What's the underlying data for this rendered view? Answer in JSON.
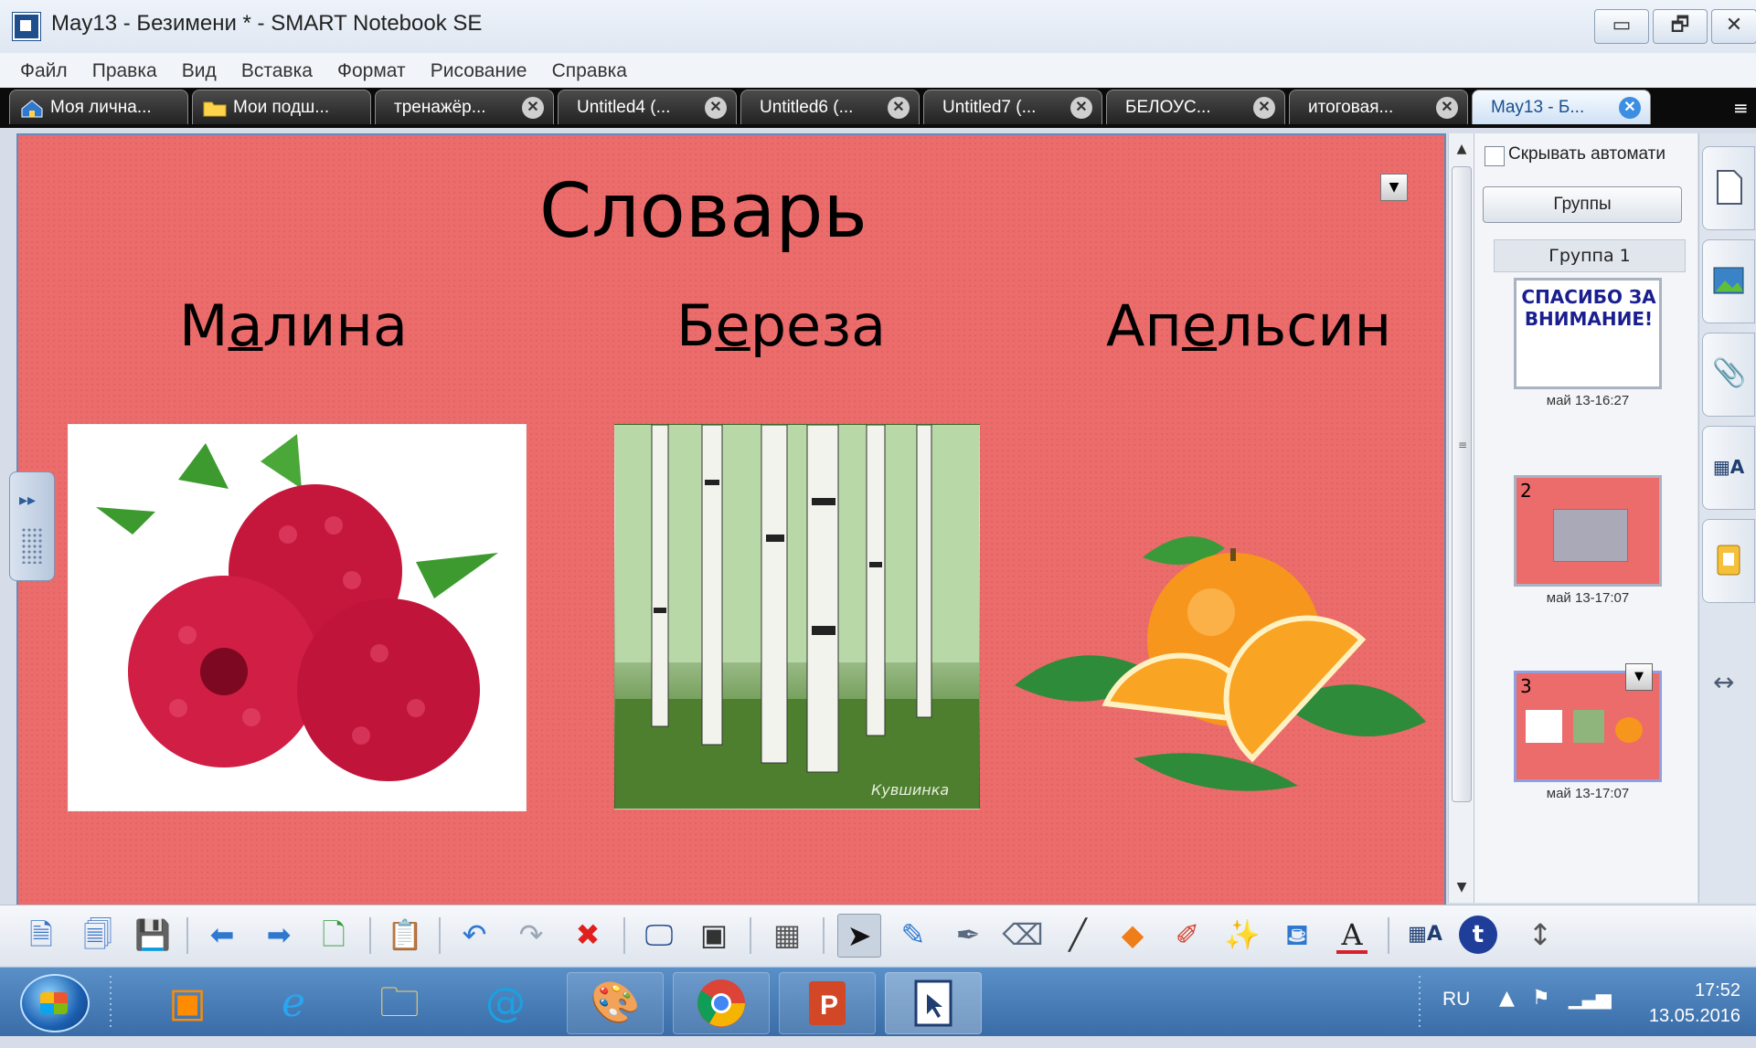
{
  "window": {
    "title": "May13 - Безимени * - SMART Notebook SE",
    "buttons": [
      "▭",
      "🗗",
      "✕"
    ]
  },
  "menu": [
    "Файл",
    "Правка",
    "Вид",
    "Вставка",
    "Формат",
    "Рисование",
    "Справка"
  ],
  "tabs": [
    {
      "label": "Моя лична...",
      "icon": "home-icon",
      "closable": false
    },
    {
      "label": "Мои подш...",
      "icon": "folder-icon",
      "closable": false
    },
    {
      "label": "тренажёр...",
      "closable": true
    },
    {
      "label": "Untitled4 (...",
      "closable": true
    },
    {
      "label": "Untitled6 (...",
      "closable": true
    },
    {
      "label": "Untitled7 (...",
      "closable": true
    },
    {
      "label": "БЕЛОУС...",
      "closable": true
    },
    {
      "label": "итоговая...",
      "closable": true
    },
    {
      "label": "May13 - Б...",
      "closable": true,
      "active": true
    }
  ],
  "slide": {
    "title": "Словарь",
    "words": [
      {
        "before": "М",
        "underlined": "а",
        "after": "лина"
      },
      {
        "before": "Б",
        "underlined": "е",
        "after": "реза"
      },
      {
        "before": "Ап",
        "underlined": "е",
        "after": "льсин"
      }
    ],
    "background": "#ec6b6b",
    "watermark": "Кувшинка"
  },
  "sidebar": {
    "auto_hide_label": "Скрывать автомати",
    "groups_button": "Группы",
    "group_header": "Группа 1",
    "thumb1_text": "СПАСИБО ЗА ВНИМАНИЕ!",
    "pages": [
      {
        "number": "",
        "caption": "май 13-16:27"
      },
      {
        "number": "2",
        "caption": "май 13-17:07"
      },
      {
        "number": "3",
        "caption": "май 13-17:07"
      }
    ]
  },
  "taskbar": {
    "lang": "RU",
    "time": "17:52",
    "date": "13.05.2016"
  }
}
